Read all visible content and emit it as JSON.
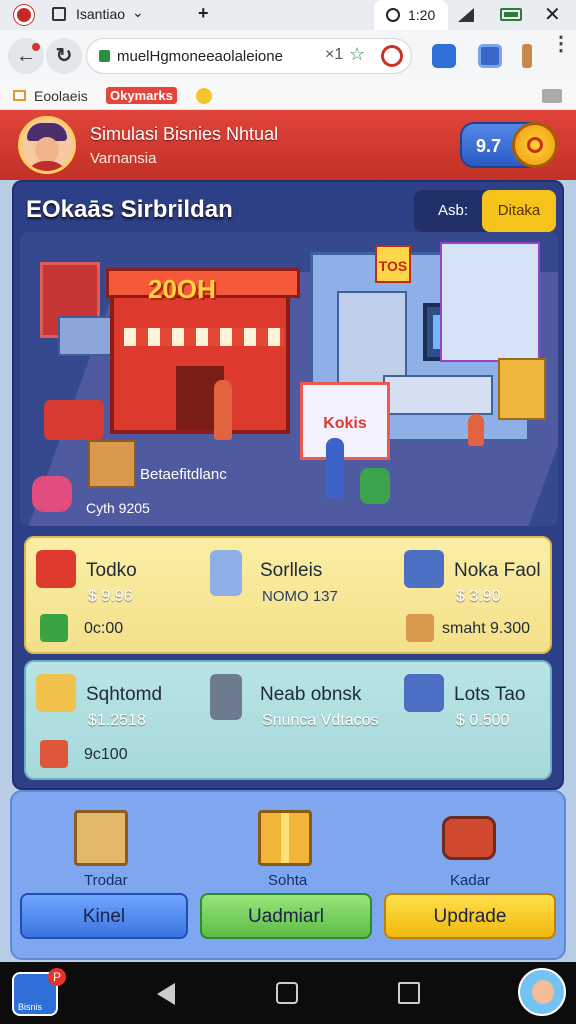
{
  "browser": {
    "tab_title": "Isantiao",
    "time": "1:20",
    "url": "muelHgmoneeaolaleione",
    "x_label": "×1",
    "bookmark_label": "Eoolaeis",
    "bookmark_brand": "Okymarks"
  },
  "header": {
    "title": "Simulasi Bisnies Nhtual",
    "subtitle": "Varnansia",
    "coins": "9.7"
  },
  "scene": {
    "title": "EOkaās Sirbrildan",
    "top_label": "Asb:",
    "top_button": "Ditaka",
    "store_sign": "20OH",
    "tech_sign": "TOS",
    "board_sign": "Kokis",
    "caption_title": "Betaefitdlanc",
    "caption_value": "Cyth 9205"
  },
  "cards": {
    "yellow": [
      {
        "name": "Todko",
        "price": "$ 9.96"
      },
      {
        "name": "Sorlleis",
        "price": "NOMO 137"
      },
      {
        "name": "Noka Faol",
        "price": "$ 3.90"
      }
    ],
    "yellow_footer_left": "0c:00",
    "yellow_footer_right": "smaht 9.300",
    "teal": [
      {
        "name": "Sqhtomd",
        "price": "$1.2518"
      },
      {
        "name": "Neab obnsk",
        "price": "Snunca Vdtacos"
      },
      {
        "name": "Lots Tao",
        "price": "$ 0.500"
      }
    ],
    "teal_footer_left": "9c100"
  },
  "bottom": {
    "labels": [
      "Trodar",
      "Sohta",
      "Kadar"
    ],
    "buttons": [
      "Kinel",
      "Uadmiarl",
      "Updrade"
    ]
  },
  "navbar": {
    "store_badge": "P",
    "store_label": "Bisnis"
  }
}
